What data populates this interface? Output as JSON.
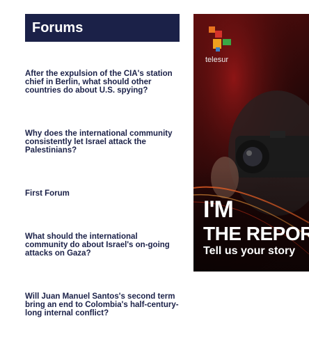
{
  "forums": {
    "title": "Forums",
    "items": [
      {
        "label": "After the expulsion of the CIA's station chief in Berlin, what should other countries do about U.S. spying?"
      },
      {
        "label": "Why does the international community consistently let Israel attack the Palestinians?"
      },
      {
        "label": "First Forum"
      },
      {
        "label": "What should the international community do about Israel's on-going attacks on Gaza?"
      },
      {
        "label": "Will Juan Manuel Santos's second term bring an end to Colombia's half-century-long internal conflict?"
      }
    ]
  },
  "promo": {
    "brand": "telesur",
    "headline_line1": "I'M",
    "headline_line2": "THE REPORTER",
    "tagline": "Tell us your story"
  }
}
